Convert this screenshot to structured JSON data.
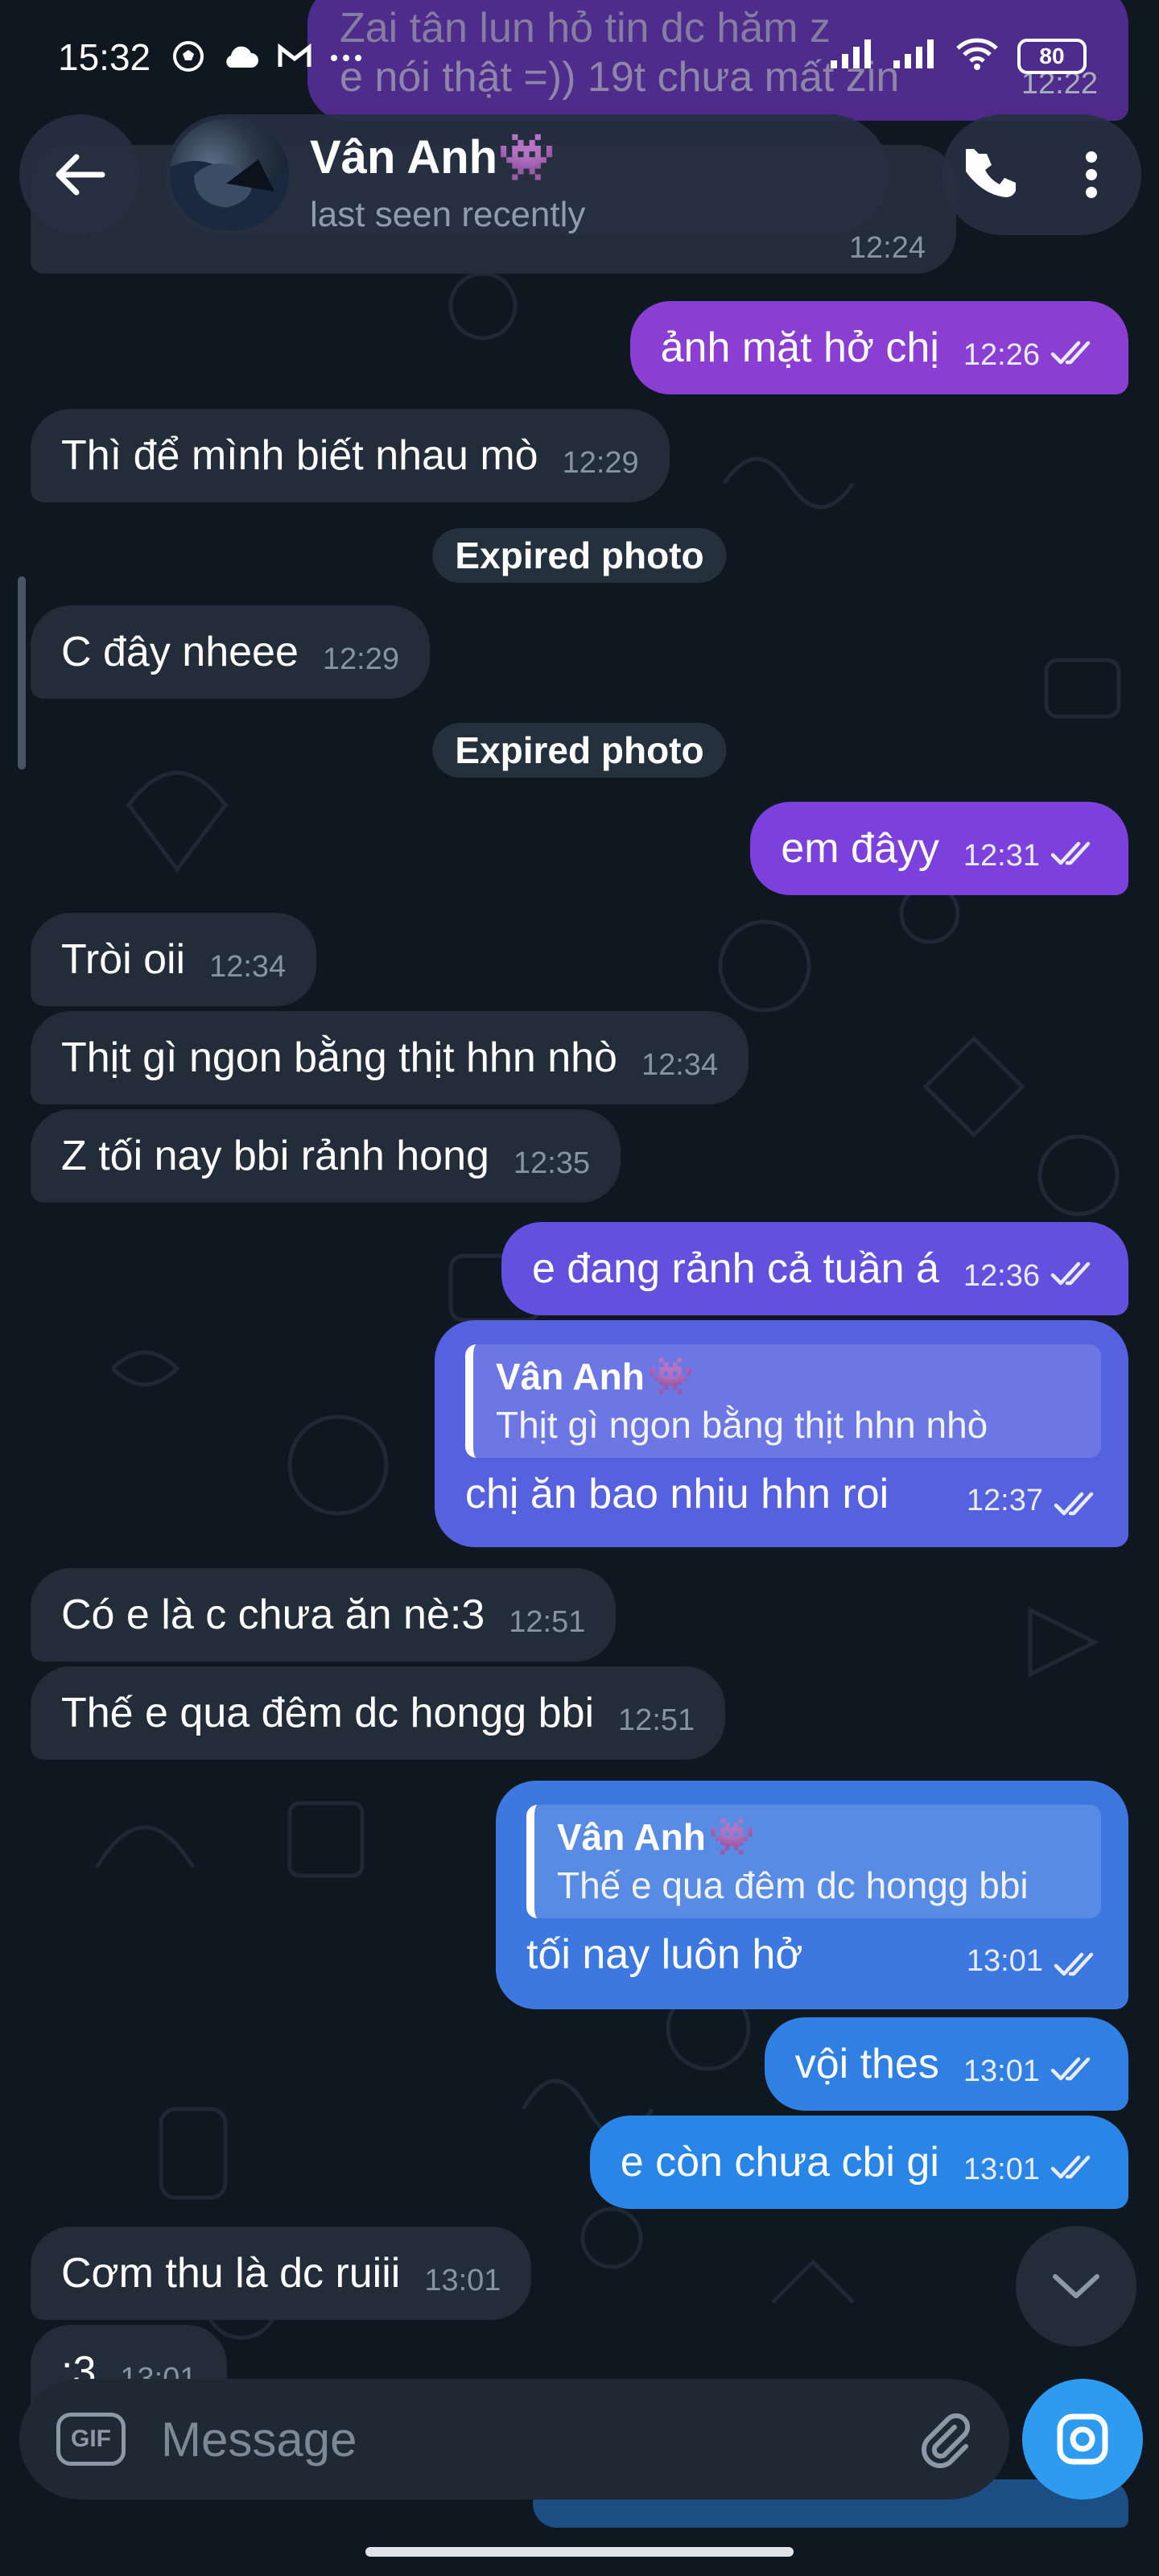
{
  "status_bar": {
    "time": "15:32",
    "battery": "80"
  },
  "header": {
    "contact_name": "Vân Anh",
    "contact_emoji": "👾",
    "contact_status": "last seen recently"
  },
  "colors": {
    "background": "#0f1721",
    "incoming_bubble": "#232d39",
    "accent": "#2d9bf0"
  },
  "partial_top_messages": {
    "line1": "Zai tân lun hỏ tin dc hăm z",
    "line2": "e nói thật =)) 19t chưa mất zin",
    "time1": "12:22",
    "time2": "12:24"
  },
  "messages": [
    {
      "id": "m1",
      "dir": "out",
      "text": "ảnh mặt hở chị",
      "time": "12:26"
    },
    {
      "id": "m2",
      "dir": "in",
      "text": "Thì để mình biết nhau mò",
      "time": "12:29"
    },
    {
      "id": "s1",
      "type": "service",
      "text": "Expired photo"
    },
    {
      "id": "m3",
      "dir": "in",
      "text": "C đây nheee",
      "time": "12:29"
    },
    {
      "id": "s2",
      "type": "service",
      "text": "Expired photo"
    },
    {
      "id": "m4",
      "dir": "out",
      "text": "em đâyy",
      "time": "12:31"
    },
    {
      "id": "m5",
      "dir": "in",
      "text": "Tròi oii",
      "time": "12:34"
    },
    {
      "id": "m6",
      "dir": "in",
      "text": "Thịt gì ngon bằng thịt hhn nhò",
      "time": "12:34"
    },
    {
      "id": "m7",
      "dir": "in",
      "text": "Z tối nay bbi rảnh hong",
      "time": "12:35"
    },
    {
      "id": "m8",
      "dir": "out",
      "text": "e đang rảnh cả tuần á",
      "time": "12:36"
    },
    {
      "id": "m9",
      "dir": "out",
      "reply_name": "Vân Anh",
      "reply_text": "Thịt gì ngon bằng thịt hhn nhò",
      "text": "chị ăn bao nhiu hhn roi",
      "time": "12:37"
    },
    {
      "id": "m10",
      "dir": "in",
      "text": "Có e là c chưa ăn nè:3",
      "time": "12:51"
    },
    {
      "id": "m11",
      "dir": "in",
      "text": "Thế e qua đêm dc hongg bbi",
      "time": "12:51"
    },
    {
      "id": "m12",
      "dir": "out",
      "reply_name": "Vân Anh",
      "reply_text": "Thế e qua đêm dc hongg bbi",
      "text": "tối nay luôn hở",
      "time": "13:01"
    },
    {
      "id": "m13",
      "dir": "out",
      "text": "vội thes",
      "time": "13:01"
    },
    {
      "id": "m14",
      "dir": "out",
      "text": "e còn chưa cbi gi",
      "time": "13:01"
    },
    {
      "id": "m15",
      "dir": "in",
      "text": "Cơm thu là dc ruiii",
      "time": "13:01"
    },
    {
      "id": "m16",
      "dir": "in",
      "text": ":3",
      "time": "13:01"
    }
  ],
  "input": {
    "gif_label": "GIF",
    "placeholder": "Message"
  },
  "icons": {
    "back": "arrow-left-icon",
    "call": "phone-icon",
    "more": "more-vertical-icon",
    "attach": "paperclip-icon",
    "camera": "camera-icon",
    "scroll_down": "chevron-down-icon"
  }
}
